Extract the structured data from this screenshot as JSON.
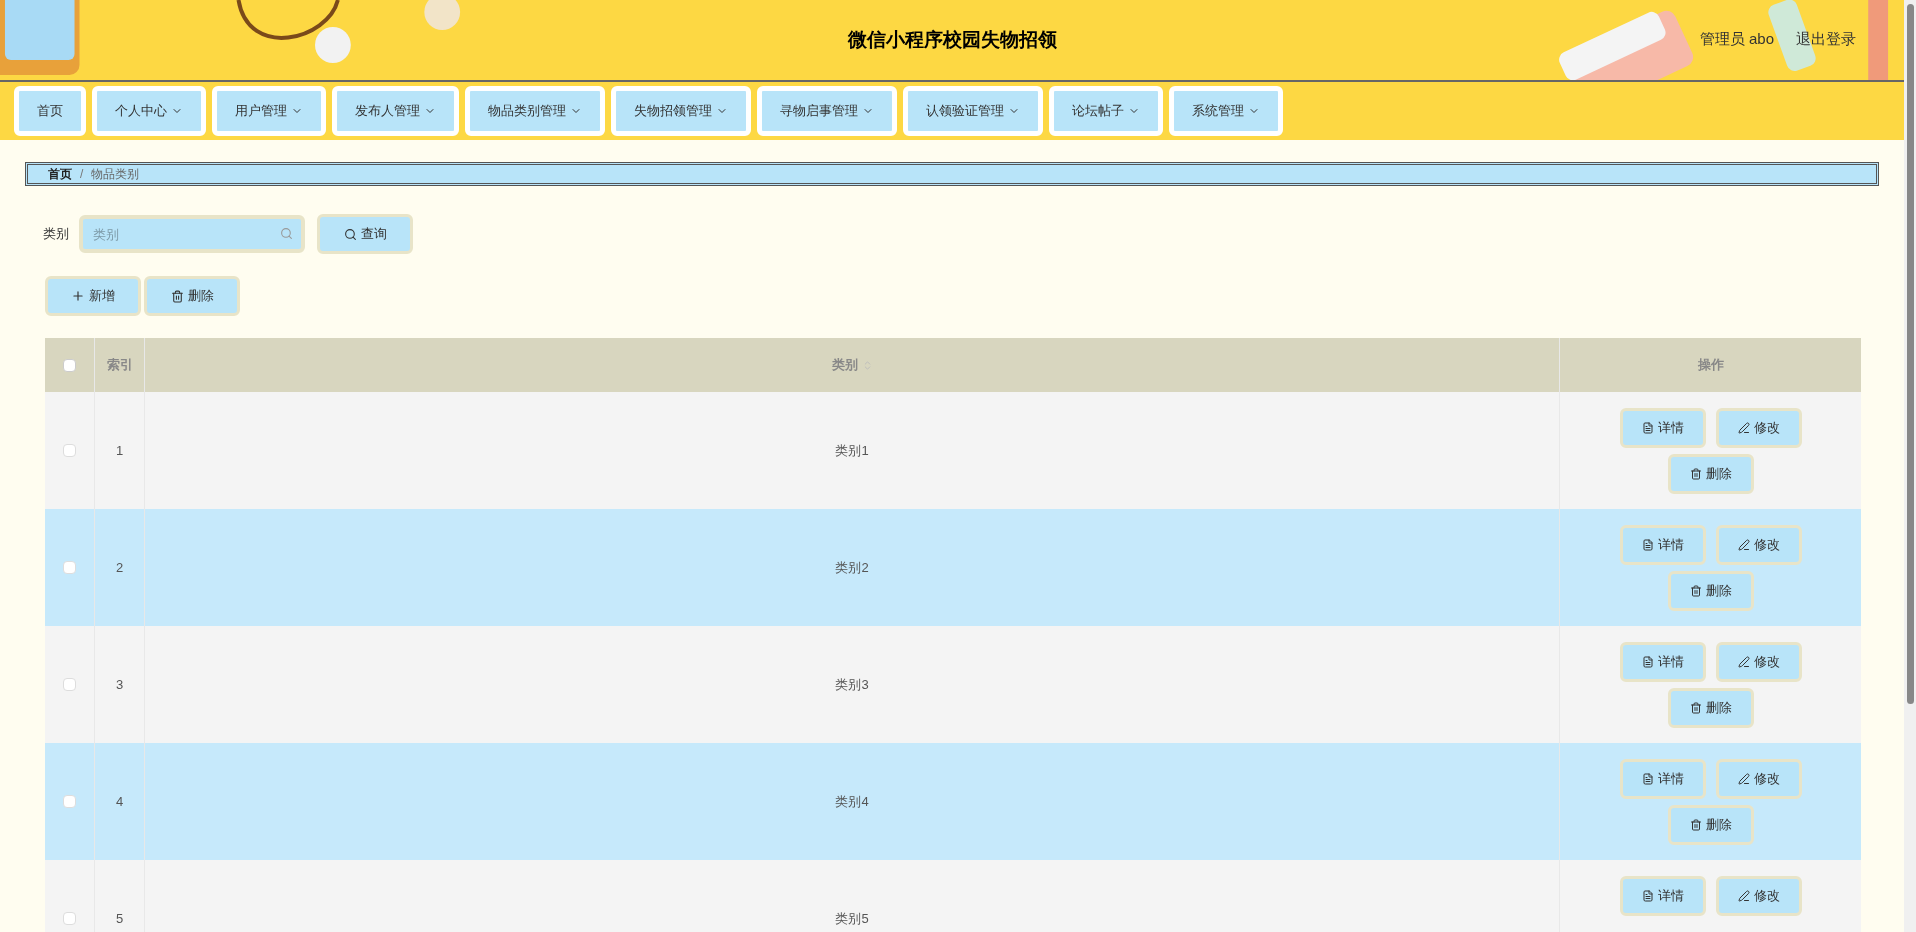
{
  "header": {
    "title": "微信小程序校园失物招领",
    "user": "管理员 abo",
    "logout": "退出登录"
  },
  "nav": [
    {
      "label": "首页",
      "dropdown": false
    },
    {
      "label": "个人中心",
      "dropdown": true
    },
    {
      "label": "用户管理",
      "dropdown": true
    },
    {
      "label": "发布人管理",
      "dropdown": true
    },
    {
      "label": "物品类别管理",
      "dropdown": true
    },
    {
      "label": "失物招领管理",
      "dropdown": true
    },
    {
      "label": "寻物启事管理",
      "dropdown": true
    },
    {
      "label": "认领验证管理",
      "dropdown": true
    },
    {
      "label": "论坛帖子",
      "dropdown": true
    },
    {
      "label": "系统管理",
      "dropdown": true
    }
  ],
  "breadcrumb": {
    "items": [
      "首页",
      "物品类别"
    ],
    "separator": "/"
  },
  "search": {
    "label": "类别",
    "placeholder": "类别",
    "button": "查询"
  },
  "actions": [
    "新增",
    "删除"
  ],
  "table": {
    "select_all_checked": false,
    "columns": [
      "索引",
      "类别",
      "操作"
    ],
    "rows": [
      {
        "index": "1",
        "category": "类别1",
        "checked": false,
        "actions": [
          "详情",
          "修改",
          "删除"
        ]
      },
      {
        "index": "2",
        "category": "类别2",
        "checked": false,
        "actions": [
          "详情",
          "修改",
          "删除"
        ]
      },
      {
        "index": "3",
        "category": "类别3",
        "checked": false,
        "actions": [
          "详情",
          "修改",
          "删除"
        ]
      },
      {
        "index": "4",
        "category": "类别4",
        "checked": false,
        "actions": [
          "详情",
          "修改",
          "删除"
        ]
      },
      {
        "index": "5",
        "category": "类别5",
        "checked": false,
        "actions": [
          "详情",
          "修改"
        ]
      }
    ]
  }
}
